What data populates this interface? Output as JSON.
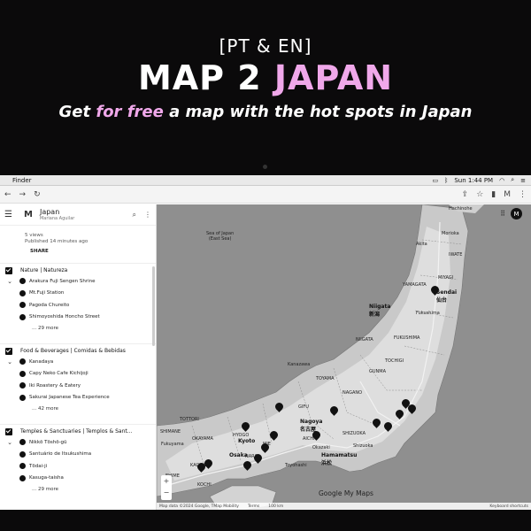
{
  "banner": {
    "tag": "[PT & EN]",
    "title_plain": "MAP 2 ",
    "title_accent": "JAPAN",
    "sub_pre": "Get ",
    "sub_accent": "for free",
    "sub_post": " a map with the hot spots in Japan",
    "accent_color": "#f0a8ea"
  },
  "menubar": {
    "app_name": "Finder",
    "clock": "Sun 1:44 PM"
  },
  "sidebar": {
    "map_title": "Japan",
    "author": "Mariana Aguilar",
    "views": "5 views",
    "published": "Published 14 minutes ago",
    "share_label": "SHARE",
    "layers": [
      {
        "name": "Nature | Natureza",
        "places": [
          "Arakura Fuji Sengen Shrine",
          "Mt.Fuji Station",
          "Pagoda Chureito",
          "Shimoyoshida Honcho Street"
        ],
        "more": "... 29 more"
      },
      {
        "name": "Food & Beverages | Comidas & Bebidas",
        "places": [
          "Kanadaya",
          "Capy Neko Cafe Kichijoji",
          "Iki Roastery & Eatery",
          "Sakurai Japanese Tea Experience"
        ],
        "more": "... 42 more"
      },
      {
        "name": "Temples & Sanctuaries | Templos & Sant...",
        "places": [
          "Nikkō Tōshō-gū",
          "Santuário de Itsukushima",
          "Tōdai-ji",
          "Kasuga-taisha"
        ],
        "more": "... 29 more"
      }
    ]
  },
  "map": {
    "sea_label": "Sea of Japan\n(East Sea)",
    "cities": {
      "niigata": "Niigata",
      "niigata_jp": "新潟",
      "sendai": "Sendai",
      "sendai_jp": "仙台",
      "nagoya": "Nagoya",
      "nagoya_jp": "名古屋",
      "hamamatsu": "Hamamatsu",
      "hamamatsu_jp": "浜松",
      "osaka": "Osaka",
      "kyoto": "Kyoto",
      "kanazawa": "Kanazawa",
      "akita": "Akita",
      "morioka": "Morioka",
      "hachinohe": "Hachinohe",
      "fukushima": "Fukushima",
      "yamagata": "YAMAGATA",
      "iwate": "IWATE",
      "miyagi": "MIYAGI",
      "fukushima_pref": "FUKUSHIMA",
      "niigata_pref": "NIIGATA",
      "tochigi": "TOCHIGI",
      "gunma": "GUNMA",
      "nagano": "NAGANO",
      "toyama": "TOYAMA",
      "gifu": "GIFU",
      "shizuoka": "SHIZUOKA",
      "aichi": "AICHI",
      "mie": "MIE",
      "nara": "NARA",
      "hyogo": "HYOGO",
      "tottori": "TOTTORI",
      "shimane": "SHIMANE",
      "okayama": "OKAYAMA",
      "kagawa": "KAGAWA",
      "kochi": "KOCHI",
      "ehime": "EHIME",
      "fukuyama": "Fukuyama",
      "okazaki": "Okazaki",
      "shizuoka_city": "Shizuoka",
      "toyohashi": "Toyohashi"
    },
    "user_initial": "M",
    "attribution": "Map data ©2024 Google, TMap Mobility",
    "terms": "Terms",
    "scale": "100 km",
    "shortcuts": "Keyboard shortcuts",
    "brand": "Google My Maps",
    "zoom_in": "+",
    "zoom_out": "−"
  }
}
